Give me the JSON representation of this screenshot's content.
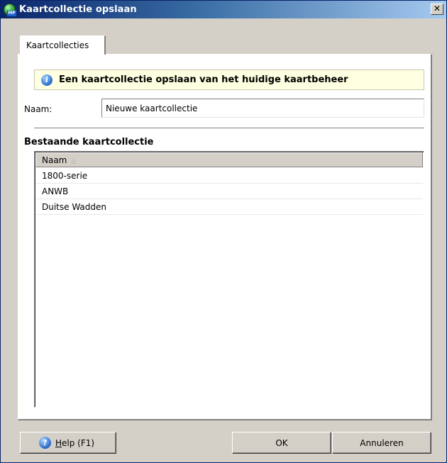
{
  "window": {
    "title": "Kaartcollectie opslaan",
    "app_icon": "globe-app-icon",
    "app_icon_badge": "MP",
    "close_label": "✕"
  },
  "tabs": [
    {
      "label": "Kaartcollecties",
      "selected": true
    }
  ],
  "info": {
    "icon": "info-icon",
    "text": "Een kaartcollectie opslaan van het huidige kaartbeheer"
  },
  "name_field": {
    "label": "Naam:",
    "value": "Nieuwe kaartcollectie"
  },
  "existing": {
    "heading": "Bestaande kaartcollectie",
    "column_header": "Naam",
    "sort_indicator": "△",
    "rows": [
      "1800-serie",
      "ANWB",
      "Duitse Wadden"
    ]
  },
  "buttons": {
    "help_prefix": "H",
    "help_rest": "elp (F1)",
    "ok": "OK",
    "cancel": "Annuleren"
  },
  "colors": {
    "title_gradient_start": "#0a246a",
    "title_gradient_end": "#a6caf0",
    "dialog_face": "#d4d0c8",
    "info_background": "#ffffe1"
  }
}
